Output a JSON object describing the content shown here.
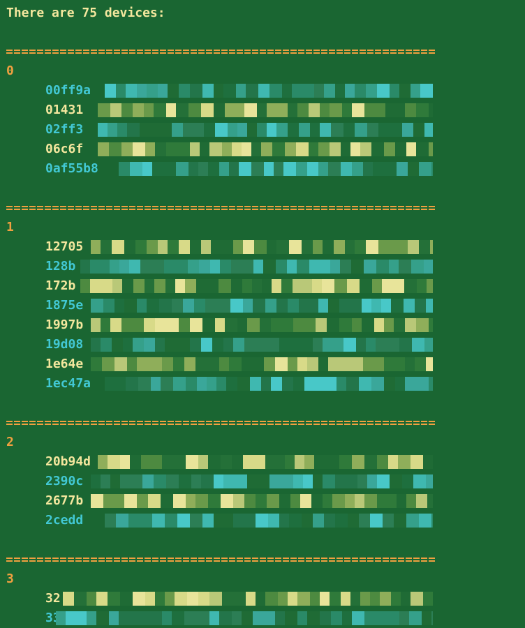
{
  "terminal": {
    "header": "There are 75 devices:",
    "groups": [
      {
        "label": "0",
        "devices": [
          {
            "text": "00ff9a",
            "tone": "cyan"
          },
          {
            "text": "01431",
            "tone": "yellow"
          },
          {
            "text": "02ff3",
            "tone": "cyan"
          },
          {
            "text": "06c6f",
            "tone": "yellow"
          },
          {
            "text": "0af55b8",
            "tone": "cyan"
          }
        ]
      },
      {
        "label": "1",
        "devices": [
          {
            "text": "12705",
            "tone": "yellow"
          },
          {
            "text": "128b",
            "tone": "cyan"
          },
          {
            "text": "172b",
            "tone": "yellow"
          },
          {
            "text": "1875e",
            "tone": "cyan"
          },
          {
            "text": "1997b",
            "tone": "yellow"
          },
          {
            "text": "19d08",
            "tone": "cyan"
          },
          {
            "text": "1e64e",
            "tone": "yellow"
          },
          {
            "text": "1ec47a",
            "tone": "cyan"
          }
        ]
      },
      {
        "label": "2",
        "devices": [
          {
            "text": "20b94d",
            "tone": "yellow"
          },
          {
            "text": "2390c",
            "tone": "cyan"
          },
          {
            "text": "2677b",
            "tone": "yellow"
          },
          {
            "text": "2cedd",
            "tone": "cyan"
          }
        ]
      },
      {
        "label": "3",
        "devices": [
          {
            "text": "32",
            "tone": "yellow"
          },
          {
            "text": "33",
            "tone": "cyan"
          }
        ]
      }
    ]
  },
  "colors": {
    "background": "#1a6632",
    "separator": "#f0a040",
    "group_label": "#f0a040",
    "text_yellow": "#f4e79e",
    "text_cyan": "#42c8d4"
  }
}
